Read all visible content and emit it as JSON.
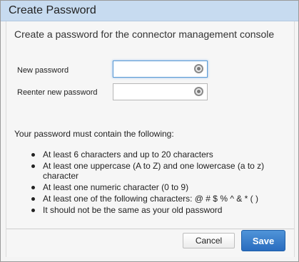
{
  "dialog": {
    "title": "Create Password",
    "heading": "Create a password for the connector management console"
  },
  "fields": {
    "new_password": {
      "label": "New password",
      "value": "",
      "placeholder": "",
      "icon": "eye-icon"
    },
    "reenter_password": {
      "label": "Reenter new password",
      "value": "",
      "placeholder": "",
      "icon": "eye-icon"
    }
  },
  "requirements": {
    "intro": "Your password must contain the following:",
    "items": [
      "At least 6 characters and up to 20 characters",
      "At least one uppercase (A to Z) and one lowercase (a to z) character",
      "At least one numeric character (0 to 9)",
      "At least one of the following characters: @ # $ % ^ & * ( )",
      "It should not be the same as your old password"
    ]
  },
  "buttons": {
    "cancel": "Cancel",
    "save": "Save"
  },
  "colors": {
    "titlebar": "#c7dbf0",
    "primary_button": "#2a6cbf",
    "focus_border": "#5b9bd5"
  }
}
